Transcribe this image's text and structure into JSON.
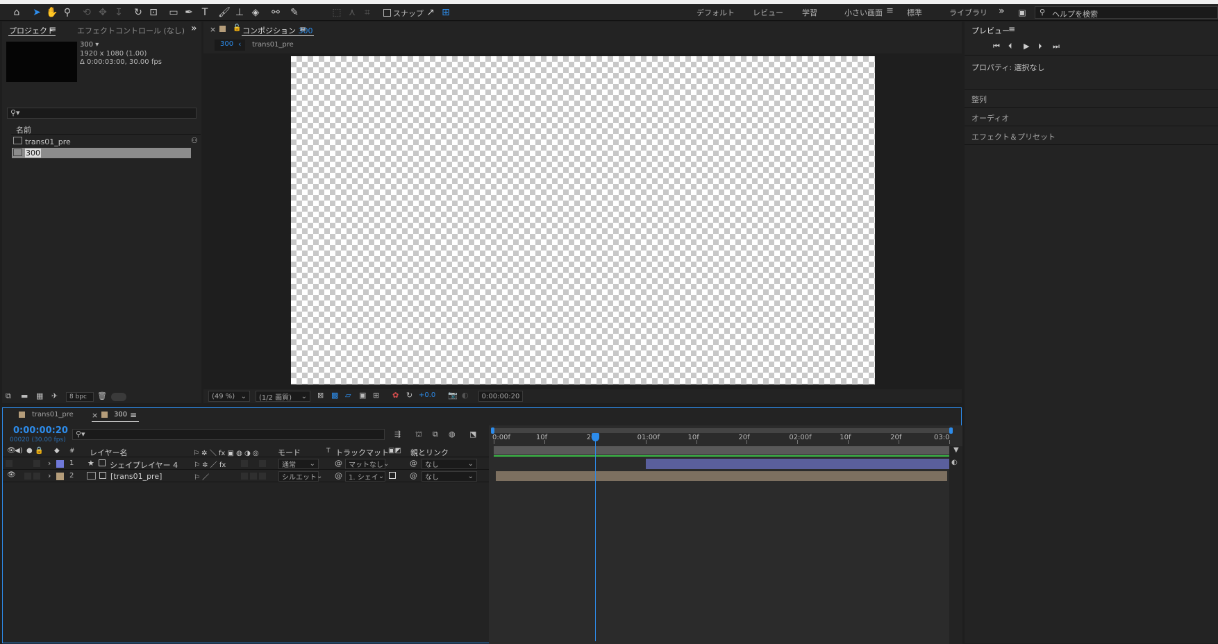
{
  "toolbar": {
    "snap_label": "スナップ",
    "workspaces": [
      "デフォルト",
      "レビュー",
      "学習",
      "小さい画面",
      "標準",
      "ライブラリ"
    ],
    "active_workspace": "小さい画面",
    "help_placeholder": "ヘルプを検索"
  },
  "project": {
    "tab_project": "プロジェクト",
    "tab_effects": "エフェクトコントロール (なし)",
    "comp_name": "300",
    "resolution": "1920 x 1080 (1.00)",
    "duration": "Δ 0:00:03:00, 30.00 fps",
    "col_name": "名前",
    "items": [
      "trans01_pre",
      "300"
    ],
    "bpc": "8 bpc"
  },
  "comp": {
    "tab_label": "コンポジション",
    "tab_name": "300",
    "breadcrumb_active": "300",
    "breadcrumb_next": "trans01_pre",
    "zoom": "(49 %)",
    "quality": "(1/2 画質)",
    "exposure": "+0.0",
    "timecode": "0:00:00:20"
  },
  "right": {
    "preview_title": "プレビュー",
    "properties": "プロパティ: 選択なし",
    "sections": [
      "整列",
      "オーディオ",
      "エフェクト＆プリセット"
    ]
  },
  "timeline": {
    "tabs": [
      "trans01_pre",
      "300"
    ],
    "timecode": "0:00:00:20",
    "fps": "00020 (30.00 fps)",
    "headers": {
      "num": "#",
      "layer_name": "レイヤー名",
      "mode": "モード",
      "t": "T",
      "track_matte": "トラックマット",
      "parent": "親とリンク"
    },
    "layers": [
      {
        "num": "1",
        "name": "シェイプレイヤー 4",
        "mode": "通常",
        "matte": "マットなし",
        "parent": "なし",
        "color": "#6f78d8"
      },
      {
        "num": "2",
        "name": "[trans01_pre]",
        "mode": "シルエット",
        "matte": "1. シェイ",
        "parent": "なし",
        "color": "#b59d7a"
      }
    ],
    "ruler": [
      "0:00f",
      "10f",
      "20f",
      "01:00f",
      "10f",
      "20f",
      "02:00f",
      "10f",
      "20f",
      "03:0"
    ],
    "current_frame": 20,
    "total_frames": 90,
    "layer1_start_frame": 30
  },
  "colors": {
    "accent": "#2d8ceb",
    "work_bar": "#595959",
    "green_line": "#3bb846",
    "layer1_bar": "#5a5f9c",
    "layer2_bar": "#7d7060"
  }
}
